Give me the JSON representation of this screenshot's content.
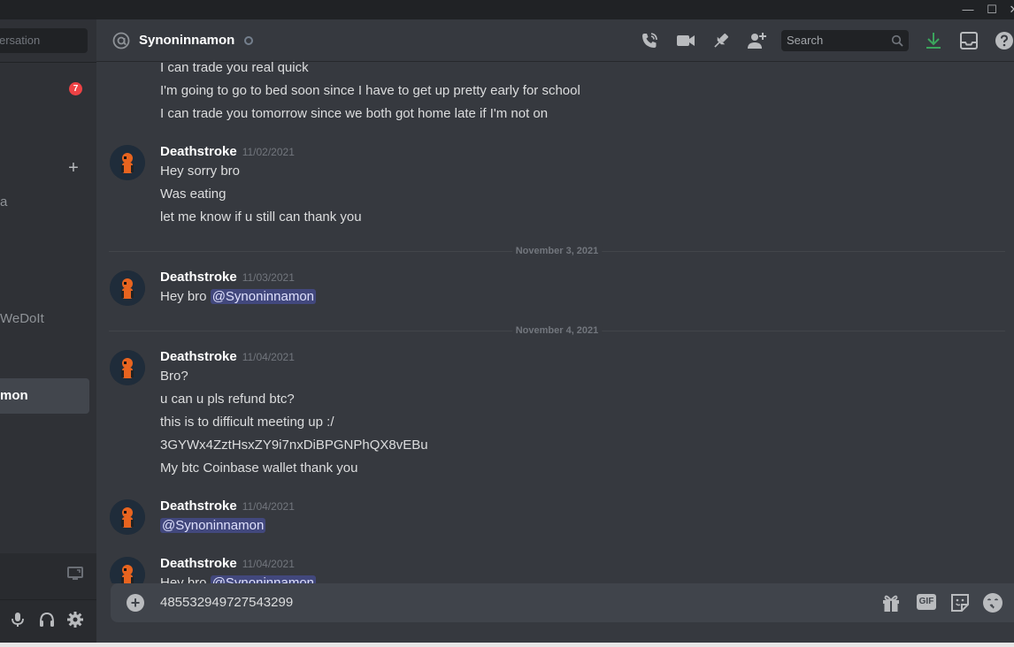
{
  "window": {
    "minimize": "—",
    "maximize": "☐",
    "close": "✕"
  },
  "sidebar": {
    "search_text": "ersation",
    "badge": "7",
    "plus": "+",
    "items": [
      {
        "label": "a"
      },
      {
        "label": "WeDoIt"
      },
      {
        "label": "mon"
      }
    ],
    "icons": [
      "screen-share-icon",
      "microphone-icon",
      "headphones-icon",
      "gear-icon"
    ]
  },
  "header": {
    "channel_name": "Synoninnamon",
    "search_placeholder": "Search",
    "icons": [
      "call-icon",
      "video-icon",
      "pin-icon",
      "add-friend-icon",
      "download-icon",
      "inbox-icon",
      "help-icon"
    ]
  },
  "messages": {
    "group0": {
      "lines": [
        "I can trade you real quick",
        "I'm going to go to bed soon since I have to get up pretty early for school",
        "I can trade you tomorrow since we both got home late if I'm not on"
      ]
    },
    "group1": {
      "author": "Deathstroke",
      "timestamp": "11/02/2021",
      "lines": [
        "Hey sorry bro",
        "Was eating",
        "let me know if u still can thank you"
      ]
    },
    "divider1": "November 3, 2021",
    "group2": {
      "author": "Deathstroke",
      "timestamp": "11/03/2021",
      "prefix": "Hey bro ",
      "mention": "@Synoninnamon"
    },
    "divider2": "November 4, 2021",
    "group3": {
      "author": "Deathstroke",
      "timestamp": "11/04/2021",
      "lines": [
        "Bro?",
        "u can u pls refund btc?",
        "this is to difficult meeting up :/",
        "3GYWx4ZztHsxZY9i7nxDiBPGNPhQX8vEBu",
        "My btc Coinbase wallet thank you"
      ]
    },
    "group4": {
      "author": "Deathstroke",
      "timestamp": "11/04/2021",
      "mention": "@Synoninnamon"
    },
    "group5": {
      "author": "Deathstroke",
      "timestamp": "11/04/2021",
      "prefix": "Hey bro ",
      "mention": "@Synoninnamon"
    }
  },
  "composer": {
    "value": "485532949727543299",
    "gif_label": "GIF",
    "icons": [
      "gift-icon",
      "sticker-icon",
      "emoji-icon"
    ]
  },
  "colors": {
    "accent": "#5865f2",
    "badge": "#ed4245",
    "download": "#3ba55d",
    "avatar_orange": "#e8641f"
  }
}
